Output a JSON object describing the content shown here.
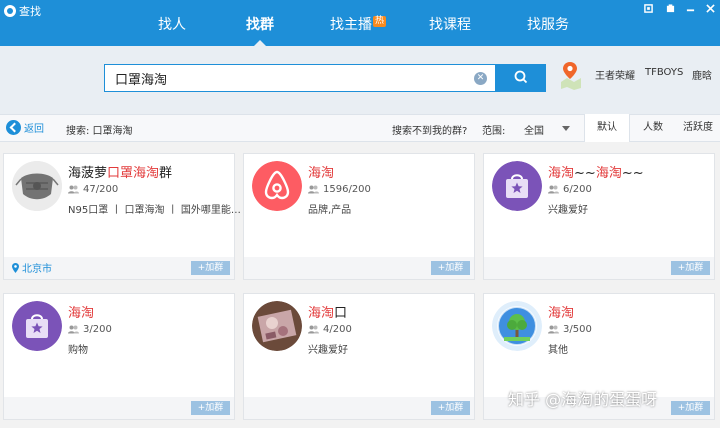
{
  "window": {
    "title": "查找"
  },
  "nav": {
    "tabs": [
      {
        "label": "找人"
      },
      {
        "label": "找群"
      },
      {
        "label": "找主播",
        "badge": "热"
      },
      {
        "label": "找课程"
      },
      {
        "label": "找服务"
      }
    ],
    "active_index": 1
  },
  "search": {
    "value": "口罩海淘",
    "hot_words": [
      "王者荣耀",
      "TFBOYS",
      "鹿晗"
    ]
  },
  "toolbar": {
    "back_label": "返回",
    "query_label": "搜索: 口罩海淘",
    "not_found_link": "搜索不到我的群?",
    "range_label": "范围:",
    "range_value": "全国",
    "sort_tabs": [
      "默认",
      "人数",
      "活跃度"
    ],
    "active_sort": 0
  },
  "cards": [
    {
      "title_parts": [
        {
          "text": "海菠萝",
          "hl": false
        },
        {
          "text": "口罩海淘",
          "hl": true
        },
        {
          "text": "群",
          "hl": false
        }
      ],
      "members": "47/200",
      "tags": "N95口罩 丨 口罩海淘 丨 国外哪里能…",
      "location": "北京市",
      "join": "+加群",
      "avatar": "mask-avatar"
    },
    {
      "title_parts": [
        {
          "text": "海淘",
          "hl": true
        }
      ],
      "members": "1596/200",
      "tags": "品牌,产品",
      "location": "",
      "join": "+加群",
      "avatar": "airbnb-logo-avatar"
    },
    {
      "title_parts": [
        {
          "text": "海淘",
          "hl": true
        },
        {
          "text": "~~",
          "hl": false
        },
        {
          "text": "海淘",
          "hl": true
        },
        {
          "text": "~~",
          "hl": false
        }
      ],
      "members": "6/200",
      "tags": "兴趣爱好",
      "location": "",
      "join": "+加群",
      "avatar": "shopping-bag-avatar"
    },
    {
      "title_parts": [
        {
          "text": "海淘",
          "hl": true
        }
      ],
      "members": "3/200",
      "tags": "购物",
      "location": "",
      "join": "+加群",
      "avatar": "shopping-bag-avatar"
    },
    {
      "title_parts": [
        {
          "text": "海淘",
          "hl": true
        },
        {
          "text": "口",
          "hl": false
        }
      ],
      "members": "4/200",
      "tags": "兴趣爱好",
      "location": "",
      "join": "+加群",
      "avatar": "photo-avatar"
    },
    {
      "title_parts": [
        {
          "text": "海淘",
          "hl": true
        }
      ],
      "members": "3/500",
      "tags": "其他",
      "location": "",
      "join": "+加群",
      "avatar": "globe-tree-avatar"
    }
  ],
  "watermark": "知乎 @海淘的蛋蛋呀",
  "colors": {
    "accent": "#1e8fd8",
    "highlight": "#e23a3a",
    "join_button": "#9cc2e2",
    "badge": "#f88a1e"
  }
}
